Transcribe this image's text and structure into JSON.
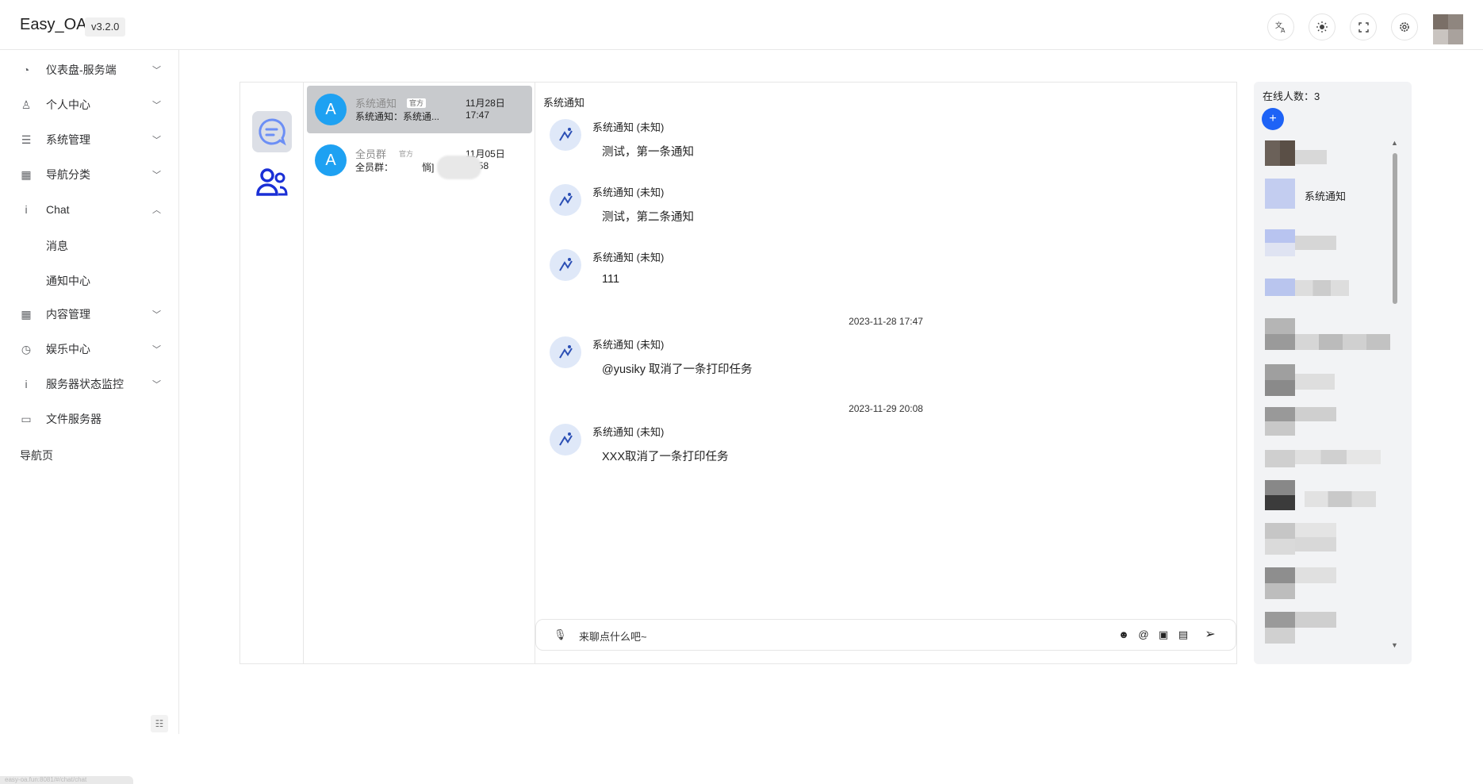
{
  "app": {
    "title": "Easy_OA",
    "version": "v3.2.0"
  },
  "header_icons": [
    "translate-icon",
    "theme-icon",
    "fullscreen-icon",
    "settings-icon"
  ],
  "sidebar": {
    "items": [
      {
        "label": "仪表盘-服务端",
        "icon": "dashboard-icon"
      },
      {
        "label": "个人中心",
        "icon": "user-icon"
      },
      {
        "label": "系统管理",
        "icon": "menu-icon"
      },
      {
        "label": "导航分类",
        "icon": "grid-icon"
      },
      {
        "label": "Chat",
        "icon": "info-icon"
      },
      {
        "label": "内容管理",
        "icon": "grid-icon"
      },
      {
        "label": "娱乐中心",
        "icon": "clock-icon"
      },
      {
        "label": "服务器状态监控",
        "icon": "info-icon"
      },
      {
        "label": "文件服务器",
        "icon": "folder-icon"
      }
    ],
    "sub_items": [
      "消息",
      "通知中心"
    ],
    "nav_page": "导航页",
    "status_url": "easy-oa.fun:8081/#/chat/chat"
  },
  "conversations": [
    {
      "avatar": "A",
      "name": "系统通知",
      "tag": "官方",
      "preview": "系统通知：系统通...",
      "date": "11月28日",
      "time": "17:47"
    },
    {
      "avatar": "A",
      "name": "全员群",
      "tag": "官方",
      "preview": "全员群：",
      "preview_tail": "惝]",
      "date": "11月05日",
      "time": "11:58"
    }
  ],
  "chat": {
    "title": "系统通知",
    "messages": [
      {
        "sender": "系统通知 (未知)",
        "text": "测试，第一条通知"
      },
      {
        "sender": "系统通知 (未知)",
        "text": "测试，第二条通知"
      },
      {
        "sender": "系统通知 (未知)",
        "text": "111"
      },
      {
        "sender": "系统通知 (未知)",
        "text": "@yusiky 取消了一条打印任务"
      },
      {
        "sender": "系统通知 (未知)",
        "text": "XXX取消了一条打印任务"
      }
    ],
    "dates": [
      "2023-11-28 17:47",
      "2023-11-29 20:08"
    ],
    "input_placeholder": "来聊点什么吧~"
  },
  "online": {
    "count_label": "在线人数：3",
    "add_label": "+",
    "visible_user": "系统通知"
  }
}
